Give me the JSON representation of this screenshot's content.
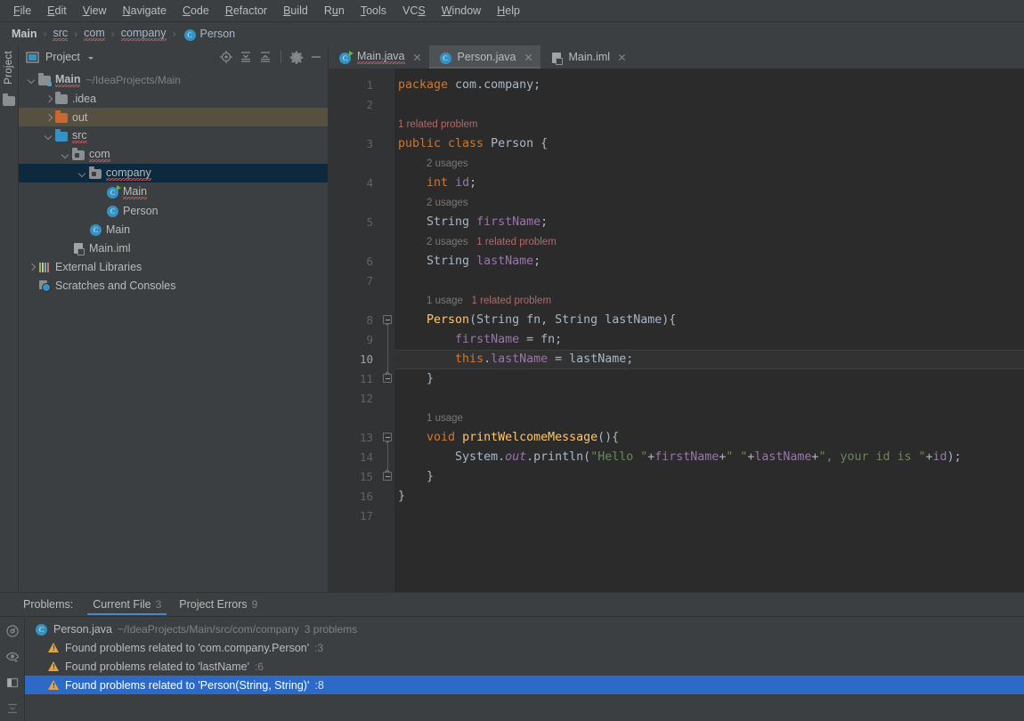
{
  "menubar": {
    "items": [
      {
        "label": "File",
        "mnemonic": "F"
      },
      {
        "label": "Edit",
        "mnemonic": "E"
      },
      {
        "label": "View",
        "mnemonic": "V"
      },
      {
        "label": "Navigate",
        "mnemonic": "N"
      },
      {
        "label": "Code",
        "mnemonic": "C"
      },
      {
        "label": "Refactor",
        "mnemonic": "R"
      },
      {
        "label": "Build",
        "mnemonic": "B"
      },
      {
        "label": "Run",
        "mnemonic": "u"
      },
      {
        "label": "Tools",
        "mnemonic": "T"
      },
      {
        "label": "VCS",
        "mnemonic": "S"
      },
      {
        "label": "Window",
        "mnemonic": "W"
      },
      {
        "label": "Help",
        "mnemonic": "H"
      }
    ]
  },
  "breadcrumb": {
    "items": [
      {
        "label": "Main",
        "bold": true,
        "squiggle": false,
        "icon": null
      },
      {
        "label": "src",
        "bold": false,
        "squiggle": true,
        "icon": null
      },
      {
        "label": "com",
        "bold": false,
        "squiggle": true,
        "icon": null
      },
      {
        "label": "company",
        "bold": false,
        "squiggle": true,
        "icon": null
      },
      {
        "label": "Person",
        "bold": false,
        "squiggle": false,
        "icon": "class-icon"
      }
    ],
    "separator": "›"
  },
  "toolstrip": {
    "project_label": "Project"
  },
  "project_panel": {
    "title": "Project",
    "toolbar": [
      "locate-icon",
      "expand-all-icon",
      "collapse-all-icon",
      "settings-icon",
      "hide-icon"
    ],
    "tree": [
      {
        "label": "Main",
        "path": "~/IdeaProjects/Main",
        "depth": 0,
        "arrow": "down",
        "icon": "folder-module",
        "state": "normal",
        "bold": true,
        "squiggle": true
      },
      {
        "label": ".idea",
        "path": "",
        "depth": 1,
        "arrow": "right",
        "icon": "folder-gray",
        "state": "normal",
        "bold": false,
        "squiggle": false
      },
      {
        "label": "out",
        "path": "",
        "depth": 1,
        "arrow": "right",
        "icon": "folder-orange",
        "state": "hovered",
        "bold": false,
        "squiggle": false
      },
      {
        "label": "src",
        "path": "",
        "depth": 1,
        "arrow": "down",
        "icon": "folder-source",
        "state": "normal",
        "bold": false,
        "squiggle": true
      },
      {
        "label": "com",
        "path": "",
        "depth": 2,
        "arrow": "down",
        "icon": "folder-package",
        "state": "normal",
        "bold": false,
        "squiggle": true
      },
      {
        "label": "company",
        "path": "",
        "depth": 3,
        "arrow": "down",
        "icon": "folder-package",
        "state": "selected",
        "bold": false,
        "squiggle": true
      },
      {
        "label": "Main",
        "path": "",
        "depth": 4,
        "arrow": "none",
        "icon": "class-runnable",
        "state": "normal",
        "bold": false,
        "squiggle": true
      },
      {
        "label": "Person",
        "path": "",
        "depth": 4,
        "arrow": "none",
        "icon": "class",
        "state": "normal",
        "bold": false,
        "squiggle": false
      },
      {
        "label": "Main",
        "path": "",
        "depth": 3,
        "arrow": "none",
        "icon": "class",
        "state": "normal",
        "bold": false,
        "squiggle": false
      },
      {
        "label": "Main.iml",
        "path": "",
        "depth": 2,
        "arrow": "none",
        "icon": "iml",
        "state": "normal",
        "bold": false,
        "squiggle": false
      },
      {
        "label": "External Libraries",
        "path": "",
        "depth": 0,
        "arrow": "right",
        "icon": "library",
        "state": "normal",
        "bold": false,
        "squiggle": false
      },
      {
        "label": "Scratches and Consoles",
        "path": "",
        "depth": 0,
        "arrow": "none",
        "icon": "scratches",
        "state": "normal",
        "bold": false,
        "squiggle": false
      }
    ]
  },
  "editor": {
    "tabs": [
      {
        "label": "Main.java",
        "icon": "class-runnable",
        "active": false,
        "squiggle": true
      },
      {
        "label": "Person.java",
        "icon": "class",
        "active": true,
        "squiggle": false
      },
      {
        "label": "Main.iml",
        "icon": "iml",
        "active": false,
        "squiggle": false
      }
    ],
    "current_line": 10,
    "lines": [
      {
        "num": 1,
        "tokens": [
          {
            "t": "package ",
            "c": "kw"
          },
          {
            "t": "com.company;",
            "c": "txt"
          }
        ]
      },
      {
        "num": 2,
        "tokens": []
      },
      {
        "num": null,
        "hint": [
          {
            "t": "1 related problem",
            "c": "relprob"
          }
        ],
        "indent": 0
      },
      {
        "num": 3,
        "tokens": [
          {
            "t": "public class ",
            "c": "kw"
          },
          {
            "t": "Person ",
            "c": "cls2"
          },
          {
            "t": "{",
            "c": "txt"
          }
        ]
      },
      {
        "num": null,
        "hint": [
          {
            "t": "2 usages",
            "c": "usage"
          }
        ],
        "indent": 4
      },
      {
        "num": 4,
        "tokens": [
          {
            "t": "    ",
            "c": "txt"
          },
          {
            "t": "int",
            "c": "kw"
          },
          {
            "t": " ",
            "c": "txt"
          },
          {
            "t": "id",
            "c": "fld"
          },
          {
            "t": ";",
            "c": "txt"
          }
        ]
      },
      {
        "num": null,
        "hint": [
          {
            "t": "2 usages",
            "c": "usage"
          }
        ],
        "indent": 4
      },
      {
        "num": 5,
        "tokens": [
          {
            "t": "    String ",
            "c": "cls2"
          },
          {
            "t": "firstName",
            "c": "fld"
          },
          {
            "t": ";",
            "c": "txt"
          }
        ]
      },
      {
        "num": null,
        "hint": [
          {
            "t": "2 usages",
            "c": "usage"
          },
          {
            "t": "   ",
            "c": "usage"
          },
          {
            "t": "1 related problem",
            "c": "relprob"
          }
        ],
        "indent": 4
      },
      {
        "num": 6,
        "tokens": [
          {
            "t": "    String ",
            "c": "cls2"
          },
          {
            "t": "lastName",
            "c": "fld"
          },
          {
            "t": ";",
            "c": "txt"
          }
        ]
      },
      {
        "num": 7,
        "tokens": []
      },
      {
        "num": null,
        "hint": [
          {
            "t": "1 usage",
            "c": "usage"
          },
          {
            "t": "   ",
            "c": "usage"
          },
          {
            "t": "1 related problem",
            "c": "relprob"
          }
        ],
        "indent": 4
      },
      {
        "num": 8,
        "tokens": [
          {
            "t": "    ",
            "c": "txt"
          },
          {
            "t": "Person",
            "c": "mth"
          },
          {
            "t": "(String ",
            "c": "cls2"
          },
          {
            "t": "fn",
            "c": "txt"
          },
          {
            "t": ", String ",
            "c": "cls2"
          },
          {
            "t": "lastName",
            "c": "txt"
          },
          {
            "t": "){",
            "c": "txt"
          }
        ]
      },
      {
        "num": 9,
        "tokens": [
          {
            "t": "        ",
            "c": "txt"
          },
          {
            "t": "firstName",
            "c": "fld"
          },
          {
            "t": " = ",
            "c": "txt"
          },
          {
            "t": "fn",
            "c": "txt"
          },
          {
            "t": ";",
            "c": "txt"
          }
        ]
      },
      {
        "num": 10,
        "tokens": [
          {
            "t": "        ",
            "c": "txt"
          },
          {
            "t": "this",
            "c": "kw"
          },
          {
            "t": ".",
            "c": "txt"
          },
          {
            "t": "lastName",
            "c": "fld"
          },
          {
            "t": " = ",
            "c": "txt"
          },
          {
            "t": "lastName",
            "c": "txt"
          },
          {
            "t": ";",
            "c": "txt"
          }
        ]
      },
      {
        "num": 11,
        "tokens": [
          {
            "t": "    }",
            "c": "txt"
          }
        ]
      },
      {
        "num": 12,
        "tokens": []
      },
      {
        "num": null,
        "hint": [
          {
            "t": "1 usage",
            "c": "usage"
          }
        ],
        "indent": 4
      },
      {
        "num": 13,
        "tokens": [
          {
            "t": "    ",
            "c": "txt"
          },
          {
            "t": "void ",
            "c": "kw"
          },
          {
            "t": "printWelcomeMessage",
            "c": "mth"
          },
          {
            "t": "(){",
            "c": "txt"
          }
        ]
      },
      {
        "num": 14,
        "tokens": [
          {
            "t": "        System.",
            "c": "txt"
          },
          {
            "t": "out",
            "c": "stat"
          },
          {
            "t": ".println(",
            "c": "txt"
          },
          {
            "t": "\"Hello \"",
            "c": "str"
          },
          {
            "t": "+",
            "c": "txt"
          },
          {
            "t": "firstName",
            "c": "fld"
          },
          {
            "t": "+",
            "c": "txt"
          },
          {
            "t": "\" \"",
            "c": "str"
          },
          {
            "t": "+",
            "c": "txt"
          },
          {
            "t": "lastName",
            "c": "fld"
          },
          {
            "t": "+",
            "c": "txt"
          },
          {
            "t": "\", your id is \"",
            "c": "str"
          },
          {
            "t": "+",
            "c": "txt"
          },
          {
            "t": "id",
            "c": "fld"
          },
          {
            "t": ");",
            "c": "txt"
          }
        ]
      },
      {
        "num": 15,
        "tokens": [
          {
            "t": "    }",
            "c": "txt"
          }
        ]
      },
      {
        "num": 16,
        "tokens": [
          {
            "t": "}",
            "c": "txt"
          }
        ]
      },
      {
        "num": 17,
        "tokens": []
      }
    ]
  },
  "problems": {
    "label": "Problems:",
    "tabs": [
      {
        "label": "Current File",
        "count": "3",
        "active": true
      },
      {
        "label": "Project Errors",
        "count": "9",
        "active": false
      }
    ],
    "side_icons": [
      "analyze-icon",
      "inspect-icon",
      "layout-icon",
      "sort-icon"
    ],
    "file": {
      "name": "Person.java",
      "path": "~/IdeaProjects/Main/src/com/company",
      "count": "3 problems"
    },
    "items": [
      {
        "label": "Found problems related to 'com.company.Person'",
        "line": ":3",
        "selected": false
      },
      {
        "label": "Found problems related to 'lastName'",
        "line": ":6",
        "selected": false
      },
      {
        "label": "Found problems related to 'Person(String, String)'",
        "line": ":8",
        "selected": true
      }
    ]
  },
  "colors": {
    "bg_panel": "#3c3f41",
    "bg_editor": "#2b2b2b",
    "bg_gutter": "#313335",
    "selection_blue": "#0d293e",
    "selection_row": "#2d6ac7",
    "hover_brown": "#55503f",
    "keyword": "#cc7832",
    "string": "#6a8759",
    "field": "#9876aa",
    "method": "#ffc66d",
    "text": "#a9b7c6",
    "hint_gray": "#787878",
    "problem_red": "#b06a6a",
    "accent_tab": "#4a88c7",
    "warn_yellow": "#e8a33d"
  }
}
